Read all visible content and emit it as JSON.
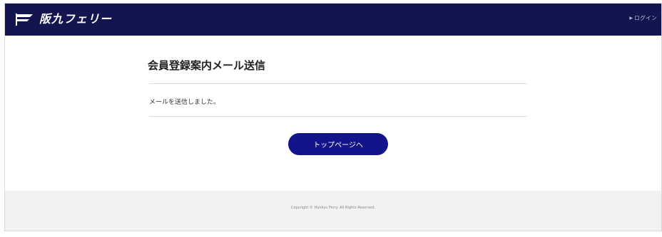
{
  "header": {
    "brand": "阪九フェリー",
    "login_label": "ログイン",
    "login_arrow": "▶"
  },
  "main": {
    "title": "会員登録案内メール送信",
    "message": "メールを送信しました。",
    "button_label": "トップページへ"
  },
  "footer": {
    "copyright": "Copyright © Hankyu Ferry. All Rights Reserved."
  },
  "colors": {
    "header_bg": "#13154e",
    "button_bg": "#13148a",
    "footer_bg": "#f2f2f2"
  },
  "icons": {
    "logo": "ferry-flag-icon",
    "login": "triangle-right-icon"
  }
}
